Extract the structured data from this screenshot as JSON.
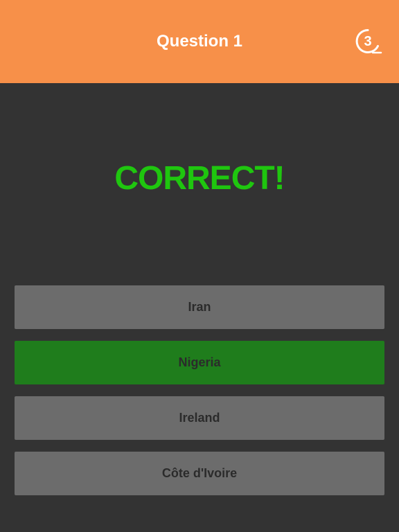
{
  "header": {
    "title": "Question 1",
    "timer": "3",
    "timer_icon": "circular-countdown-timer"
  },
  "result": {
    "text": "CORRECT!",
    "color": "#1fc60f"
  },
  "answers": [
    {
      "label": "Iran",
      "state": "default"
    },
    {
      "label": "Nigeria",
      "state": "correct"
    },
    {
      "label": "Ireland",
      "state": "default"
    },
    {
      "label": "Côte d'Ivoire",
      "state": "default"
    }
  ],
  "colors": {
    "header_bg": "#f79049",
    "page_bg": "#333333",
    "answer_default": "#6c6c6c",
    "answer_correct": "#1f7d1c",
    "answer_text": "#2b2b2b"
  }
}
